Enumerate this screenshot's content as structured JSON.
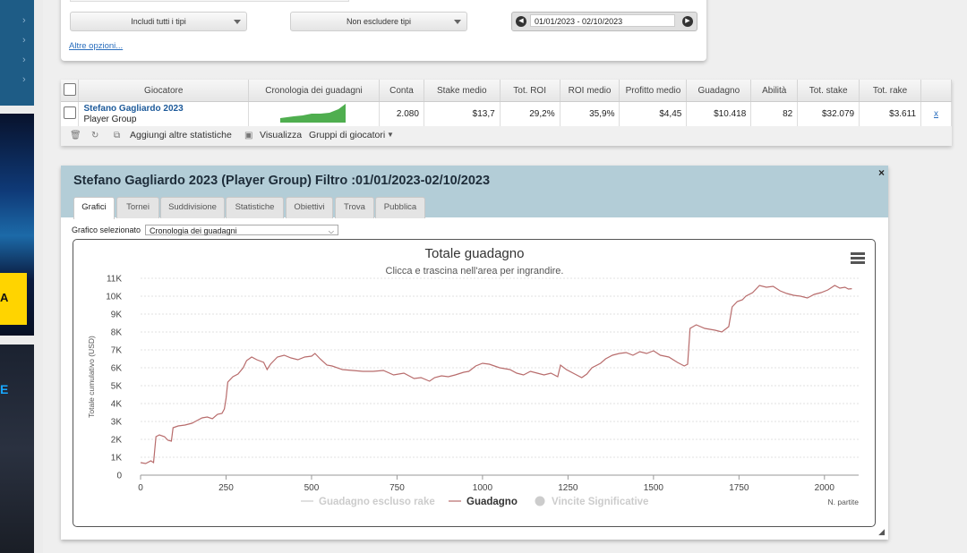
{
  "filters": {
    "type_include": "Includi tutti i tipi",
    "type_exclude": "Non escludere tipi",
    "date_range": "01/01/2023 - 02/10/2023",
    "more_options": "Altre opzioni..."
  },
  "table": {
    "headers": [
      "Giocatore",
      "Cronologia dei guadagni",
      "Conta",
      "Stake medio",
      "Tot. ROI",
      "ROI medio",
      "Profitto medio",
      "Guadagno",
      "Abilità",
      "Tot. stake",
      "Tot. rake"
    ],
    "row": {
      "name": "Stefano Gagliardo 2023",
      "group": "Player Group",
      "values": [
        "2.080",
        "$13,7",
        "29,2%",
        "35,9%",
        "$4,45",
        "$10.418",
        "82",
        "$32.079",
        "$3.611"
      ],
      "remove": "x"
    },
    "toolbar": {
      "add_stats": "Aggiungi altre statistiche",
      "view": "Visualizza",
      "groups": "Gruppi di giocatori"
    }
  },
  "panel": {
    "title": "Stefano Gagliardo 2023 (Player Group) Filtro :01/01/2023-02/10/2023",
    "close": "×",
    "tabs": [
      "Grafici",
      "Tornei",
      "Suddivisione",
      "Statistiche",
      "Obiettivi",
      "Trova",
      "Pubblica"
    ],
    "active_tab": "Grafici",
    "graph_select_label": "Grafico selezionato",
    "graph_select_value": "Cronologia dei guadagni"
  },
  "chart_data": {
    "type": "line",
    "title": "Totale guadagno",
    "subtitle": "Clicca e trascina nell'area per ingrandire.",
    "xlabel": "N. partite",
    "ylabel": "Totale cumulativo (USD)",
    "xlim": [
      0,
      2100
    ],
    "ylim": [
      0,
      11000
    ],
    "xticks": [
      0,
      250,
      500,
      750,
      1000,
      1250,
      1500,
      1750,
      2000
    ],
    "yticks": [
      0,
      1000,
      2000,
      3000,
      4000,
      5000,
      6000,
      7000,
      8000,
      9000,
      10000,
      11000
    ],
    "ytick_labels": [
      "0",
      "1K",
      "2K",
      "3K",
      "4K",
      "5K",
      "6K",
      "7K",
      "8K",
      "9K",
      "10K",
      "11K"
    ],
    "grid": true,
    "legend_position": "bottom",
    "legend": [
      {
        "name": "Guadagno escluso rake",
        "active": false
      },
      {
        "name": "Guadagno",
        "active": true
      },
      {
        "name": "Vincite Significative",
        "active": false
      }
    ],
    "series": [
      {
        "name": "Guadagno",
        "color": "#b86c6c",
        "points": [
          [
            0,
            700
          ],
          [
            15,
            650
          ],
          [
            30,
            800
          ],
          [
            38,
            700
          ],
          [
            45,
            2150
          ],
          [
            55,
            2250
          ],
          [
            70,
            2150
          ],
          [
            80,
            1950
          ],
          [
            90,
            1900
          ],
          [
            95,
            2650
          ],
          [
            110,
            2750
          ],
          [
            130,
            2800
          ],
          [
            150,
            2900
          ],
          [
            165,
            3050
          ],
          [
            180,
            3200
          ],
          [
            195,
            3250
          ],
          [
            210,
            3150
          ],
          [
            225,
            3400
          ],
          [
            238,
            3450
          ],
          [
            245,
            3700
          ],
          [
            250,
            4300
          ],
          [
            255,
            5200
          ],
          [
            270,
            5500
          ],
          [
            285,
            5650
          ],
          [
            300,
            6000
          ],
          [
            310,
            6400
          ],
          [
            325,
            6600
          ],
          [
            340,
            6450
          ],
          [
            360,
            6300
          ],
          [
            370,
            5900
          ],
          [
            380,
            6200
          ],
          [
            400,
            6600
          ],
          [
            420,
            6700
          ],
          [
            440,
            6550
          ],
          [
            460,
            6450
          ],
          [
            480,
            6600
          ],
          [
            500,
            6650
          ],
          [
            510,
            6800
          ],
          [
            525,
            6500
          ],
          [
            545,
            6150
          ],
          [
            560,
            6100
          ],
          [
            590,
            5900
          ],
          [
            620,
            5850
          ],
          [
            650,
            5800
          ],
          [
            680,
            5800
          ],
          [
            710,
            5850
          ],
          [
            740,
            5600
          ],
          [
            770,
            5700
          ],
          [
            800,
            5400
          ],
          [
            820,
            5450
          ],
          [
            845,
            5250
          ],
          [
            860,
            5450
          ],
          [
            880,
            5550
          ],
          [
            900,
            5500
          ],
          [
            920,
            5600
          ],
          [
            945,
            5750
          ],
          [
            960,
            5800
          ],
          [
            980,
            6100
          ],
          [
            1000,
            6250
          ],
          [
            1020,
            6200
          ],
          [
            1050,
            6000
          ],
          [
            1080,
            5900
          ],
          [
            1100,
            5700
          ],
          [
            1120,
            5600
          ],
          [
            1140,
            5800
          ],
          [
            1160,
            5700
          ],
          [
            1180,
            5600
          ],
          [
            1200,
            5700
          ],
          [
            1220,
            5500
          ],
          [
            1228,
            6150
          ],
          [
            1245,
            5900
          ],
          [
            1270,
            5650
          ],
          [
            1290,
            5450
          ],
          [
            1305,
            5650
          ],
          [
            1320,
            6000
          ],
          [
            1345,
            6250
          ],
          [
            1360,
            6500
          ],
          [
            1380,
            6700
          ],
          [
            1400,
            6800
          ],
          [
            1420,
            6850
          ],
          [
            1440,
            6700
          ],
          [
            1460,
            6900
          ],
          [
            1480,
            6800
          ],
          [
            1500,
            6950
          ],
          [
            1520,
            6700
          ],
          [
            1545,
            6600
          ],
          [
            1570,
            6300
          ],
          [
            1590,
            6100
          ],
          [
            1600,
            6200
          ],
          [
            1607,
            8200
          ],
          [
            1625,
            8400
          ],
          [
            1650,
            8200
          ],
          [
            1680,
            8100
          ],
          [
            1700,
            8000
          ],
          [
            1720,
            8300
          ],
          [
            1730,
            9400
          ],
          [
            1745,
            9700
          ],
          [
            1760,
            9800
          ],
          [
            1770,
            10000
          ],
          [
            1790,
            10200
          ],
          [
            1810,
            10600
          ],
          [
            1830,
            10500
          ],
          [
            1850,
            10550
          ],
          [
            1870,
            10300
          ],
          [
            1890,
            10150
          ],
          [
            1910,
            10050
          ],
          [
            1930,
            10000
          ],
          [
            1950,
            9900
          ],
          [
            1970,
            10100
          ],
          [
            1990,
            10200
          ],
          [
            2010,
            10350
          ],
          [
            2030,
            10600
          ],
          [
            2045,
            10450
          ],
          [
            2060,
            10500
          ],
          [
            2070,
            10400
          ],
          [
            2080,
            10418
          ]
        ]
      }
    ]
  },
  "colors": {
    "accent": "#1d5a9a",
    "header_band": "#b3cdd7",
    "line": "#b86c6c"
  },
  "icons": [
    "trash-icon",
    "refresh-icon",
    "add-stats-icon",
    "view-icon",
    "dropdown-arrow-icon",
    "prev-date-icon",
    "next-date-icon",
    "menu-icon",
    "resize-icon"
  ]
}
